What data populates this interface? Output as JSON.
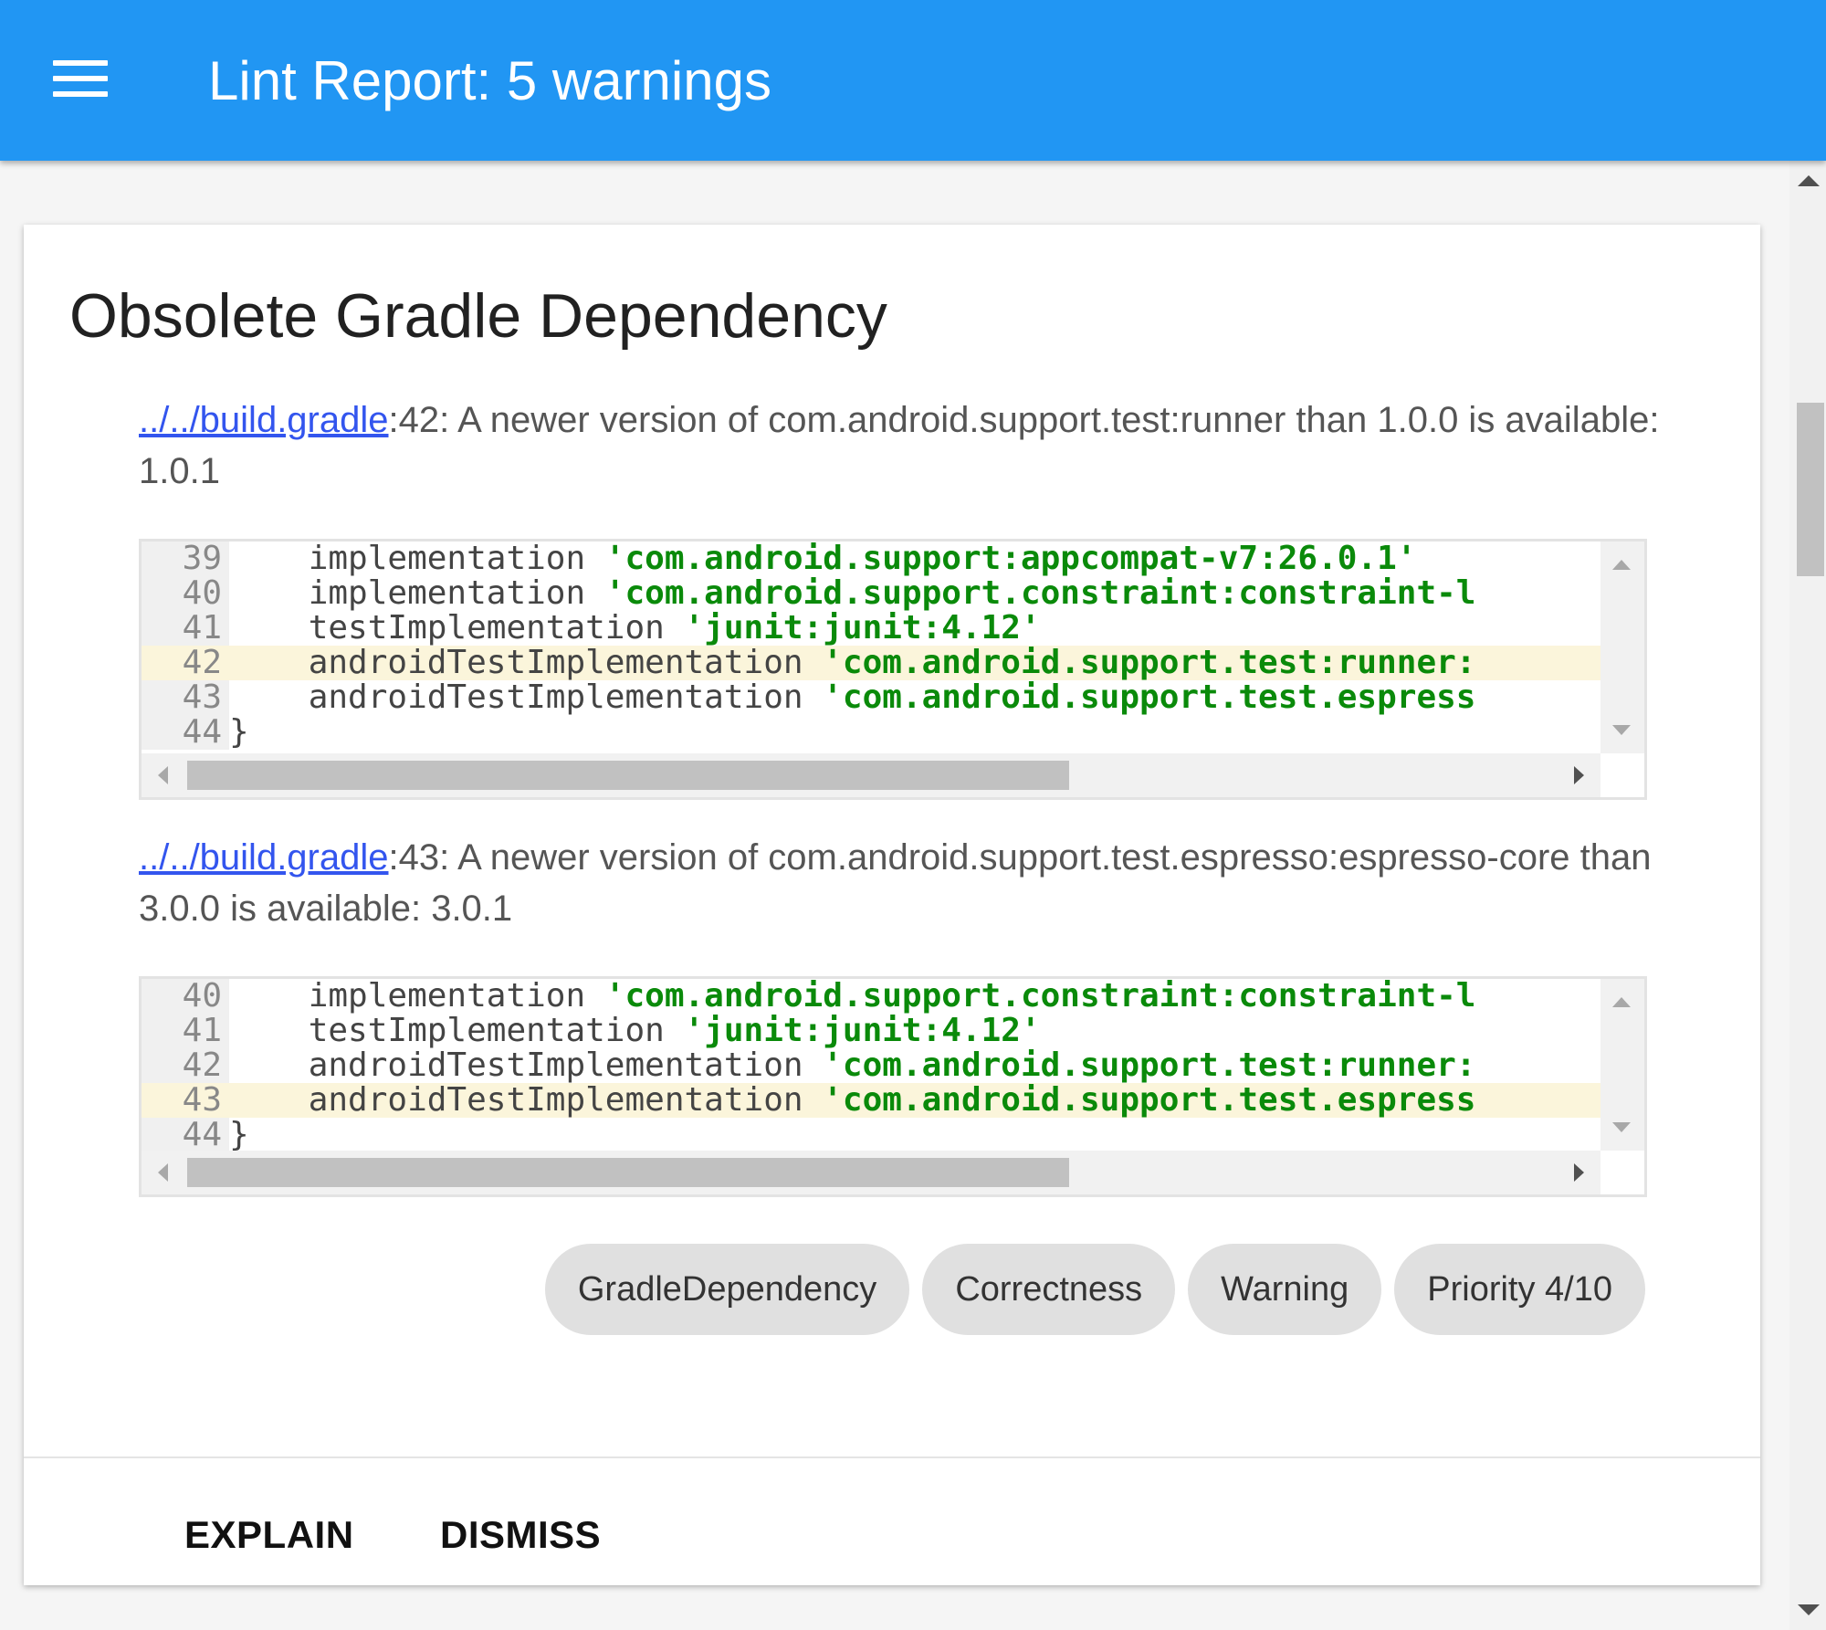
{
  "appbar": {
    "title": "Lint Report: 5 warnings"
  },
  "card": {
    "title": "Obsolete Gradle Dependency",
    "warnings": [
      {
        "link": "../../build.gradle",
        "message": ":42: A newer version of com.android.support.test:runner than 1.0.0 is available: 1.0.1",
        "code": [
          {
            "num": "39",
            "indent": "    ",
            "stmt": "implementation ",
            "str": "'com.android.support:appcompat-v7:26.0.1'",
            "highlight": false
          },
          {
            "num": "40",
            "indent": "    ",
            "stmt": "implementation ",
            "str": "'com.android.support.constraint:constraint-l",
            "highlight": false
          },
          {
            "num": "41",
            "indent": "    ",
            "stmt": "testImplementation ",
            "str": "'junit:junit:4.12'",
            "highlight": false
          },
          {
            "num": "42",
            "indent": "    ",
            "stmt": "androidTestImplementation ",
            "str": "'com.android.support.test:runner:",
            "highlight": true
          },
          {
            "num": "43",
            "indent": "    ",
            "stmt": "androidTestImplementation ",
            "str": "'com.android.support.test.espress",
            "highlight": false
          },
          {
            "num": "44",
            "indent": "",
            "stmt": "}",
            "str": "",
            "highlight": false
          }
        ]
      },
      {
        "link": "../../build.gradle",
        "message": ":43: A newer version of com.android.support.test.espresso:espresso-core than 3.0.0 is available: 3.0.1",
        "code": [
          {
            "num": "40",
            "indent": "    ",
            "stmt": "implementation ",
            "str": "'com.android.support.constraint:constraint-l",
            "highlight": false
          },
          {
            "num": "41",
            "indent": "    ",
            "stmt": "testImplementation ",
            "str": "'junit:junit:4.12'",
            "highlight": false
          },
          {
            "num": "42",
            "indent": "    ",
            "stmt": "androidTestImplementation ",
            "str": "'com.android.support.test:runner:",
            "highlight": false
          },
          {
            "num": "43",
            "indent": "    ",
            "stmt": "androidTestImplementation ",
            "str": "'com.android.support.test.espress",
            "highlight": true
          },
          {
            "num": "44",
            "indent": "",
            "stmt": "}",
            "str": "",
            "highlight": false
          }
        ]
      }
    ],
    "chips": [
      "GradleDependency",
      "Correctness",
      "Warning",
      "Priority 4/10"
    ],
    "actions": {
      "explain": "EXPLAIN",
      "dismiss": "DISMISS"
    }
  },
  "colors": {
    "appbar": "#2196f3",
    "link": "#3355ee",
    "string_literal": "#0a8a0a",
    "highlight_line": "#fbf5db",
    "chip": "#e0e0e0"
  },
  "icons": {
    "menu": "hamburger-menu-icon"
  }
}
